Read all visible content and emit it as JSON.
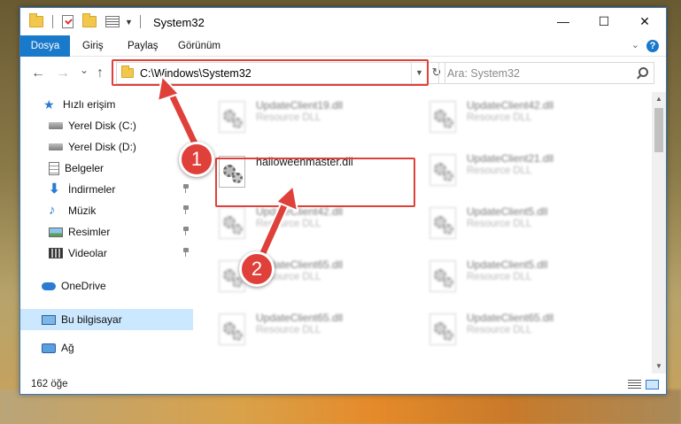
{
  "window": {
    "title": "System32"
  },
  "ribbon": {
    "tabs": [
      "Dosya",
      "Giriş",
      "Paylaş",
      "Görünüm"
    ]
  },
  "titlebar": {
    "minimize": "—",
    "maximize": "☐",
    "close": "✕"
  },
  "nav": {
    "back": "←",
    "forward": "→",
    "recent": "⌄",
    "up": "↑",
    "address": "C:\\Windows\\System32",
    "refresh": "↻",
    "search_placeholder": "Ara: System32"
  },
  "sidebar": {
    "items": [
      {
        "label": "Hızlı erişim",
        "icon": "star-icon"
      },
      {
        "label": "Yerel Disk (C:)",
        "icon": "drive-icon"
      },
      {
        "label": "Yerel Disk (D:)",
        "icon": "drive-icon"
      },
      {
        "label": "Belgeler",
        "icon": "documents-icon"
      },
      {
        "label": "İndirmeler",
        "icon": "download-icon"
      },
      {
        "label": "Müzik",
        "icon": "music-icon"
      },
      {
        "label": "Resimler",
        "icon": "pictures-icon"
      },
      {
        "label": "Videolar",
        "icon": "videos-icon"
      },
      {
        "label": "OneDrive",
        "icon": "cloud-icon"
      },
      {
        "label": "Bu bilgisayar",
        "icon": "computer-icon"
      },
      {
        "label": "Ağ",
        "icon": "network-icon"
      }
    ]
  },
  "files": [
    {
      "name": "UpdateClient19.dll",
      "type": "Resource DLL"
    },
    {
      "name": "UpdateClient42.dll",
      "type": "Resource DLL"
    },
    {
      "name": "halloweenmaster.dll",
      "type": ""
    },
    {
      "name": "UpdateClient21.dll",
      "type": "Resource DLL"
    },
    {
      "name": "UpdateClient42.dll",
      "type": "Resource DLL"
    },
    {
      "name": "UpdateClient5.dll",
      "type": "Resource DLL"
    },
    {
      "name": "UpdateClient65.dll",
      "type": "Resource DLL"
    },
    {
      "name": "UpdateClient5.dll",
      "type": "Resource DLL"
    },
    {
      "name": "UpdateClient65.dll",
      "type": "Resource DLL"
    },
    {
      "name": "UpdateClient65.dll",
      "type": "Resource DLL"
    }
  ],
  "status": {
    "count": "162 öğe"
  },
  "annotations": {
    "step1": "1",
    "step2": "2",
    "color": "#e0403a"
  }
}
